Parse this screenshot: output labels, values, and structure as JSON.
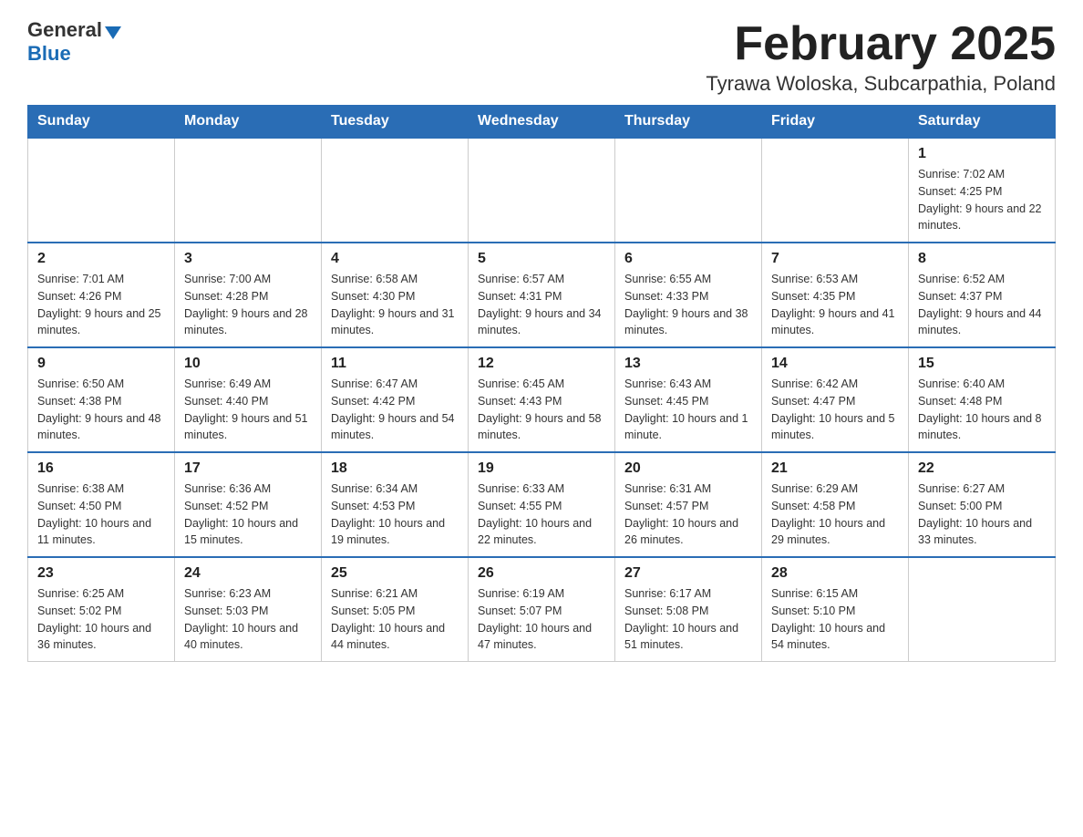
{
  "header": {
    "logo_general": "General",
    "logo_blue": "Blue",
    "month_title": "February 2025",
    "location": "Tyrawa Woloska, Subcarpathia, Poland"
  },
  "days_of_week": [
    "Sunday",
    "Monday",
    "Tuesday",
    "Wednesday",
    "Thursday",
    "Friday",
    "Saturday"
  ],
  "weeks": [
    {
      "days": [
        {
          "num": "",
          "info": ""
        },
        {
          "num": "",
          "info": ""
        },
        {
          "num": "",
          "info": ""
        },
        {
          "num": "",
          "info": ""
        },
        {
          "num": "",
          "info": ""
        },
        {
          "num": "",
          "info": ""
        },
        {
          "num": "1",
          "info": "Sunrise: 7:02 AM\nSunset: 4:25 PM\nDaylight: 9 hours and 22 minutes."
        }
      ]
    },
    {
      "days": [
        {
          "num": "2",
          "info": "Sunrise: 7:01 AM\nSunset: 4:26 PM\nDaylight: 9 hours and 25 minutes."
        },
        {
          "num": "3",
          "info": "Sunrise: 7:00 AM\nSunset: 4:28 PM\nDaylight: 9 hours and 28 minutes."
        },
        {
          "num": "4",
          "info": "Sunrise: 6:58 AM\nSunset: 4:30 PM\nDaylight: 9 hours and 31 minutes."
        },
        {
          "num": "5",
          "info": "Sunrise: 6:57 AM\nSunset: 4:31 PM\nDaylight: 9 hours and 34 minutes."
        },
        {
          "num": "6",
          "info": "Sunrise: 6:55 AM\nSunset: 4:33 PM\nDaylight: 9 hours and 38 minutes."
        },
        {
          "num": "7",
          "info": "Sunrise: 6:53 AM\nSunset: 4:35 PM\nDaylight: 9 hours and 41 minutes."
        },
        {
          "num": "8",
          "info": "Sunrise: 6:52 AM\nSunset: 4:37 PM\nDaylight: 9 hours and 44 minutes."
        }
      ]
    },
    {
      "days": [
        {
          "num": "9",
          "info": "Sunrise: 6:50 AM\nSunset: 4:38 PM\nDaylight: 9 hours and 48 minutes."
        },
        {
          "num": "10",
          "info": "Sunrise: 6:49 AM\nSunset: 4:40 PM\nDaylight: 9 hours and 51 minutes."
        },
        {
          "num": "11",
          "info": "Sunrise: 6:47 AM\nSunset: 4:42 PM\nDaylight: 9 hours and 54 minutes."
        },
        {
          "num": "12",
          "info": "Sunrise: 6:45 AM\nSunset: 4:43 PM\nDaylight: 9 hours and 58 minutes."
        },
        {
          "num": "13",
          "info": "Sunrise: 6:43 AM\nSunset: 4:45 PM\nDaylight: 10 hours and 1 minute."
        },
        {
          "num": "14",
          "info": "Sunrise: 6:42 AM\nSunset: 4:47 PM\nDaylight: 10 hours and 5 minutes."
        },
        {
          "num": "15",
          "info": "Sunrise: 6:40 AM\nSunset: 4:48 PM\nDaylight: 10 hours and 8 minutes."
        }
      ]
    },
    {
      "days": [
        {
          "num": "16",
          "info": "Sunrise: 6:38 AM\nSunset: 4:50 PM\nDaylight: 10 hours and 11 minutes."
        },
        {
          "num": "17",
          "info": "Sunrise: 6:36 AM\nSunset: 4:52 PM\nDaylight: 10 hours and 15 minutes."
        },
        {
          "num": "18",
          "info": "Sunrise: 6:34 AM\nSunset: 4:53 PM\nDaylight: 10 hours and 19 minutes."
        },
        {
          "num": "19",
          "info": "Sunrise: 6:33 AM\nSunset: 4:55 PM\nDaylight: 10 hours and 22 minutes."
        },
        {
          "num": "20",
          "info": "Sunrise: 6:31 AM\nSunset: 4:57 PM\nDaylight: 10 hours and 26 minutes."
        },
        {
          "num": "21",
          "info": "Sunrise: 6:29 AM\nSunset: 4:58 PM\nDaylight: 10 hours and 29 minutes."
        },
        {
          "num": "22",
          "info": "Sunrise: 6:27 AM\nSunset: 5:00 PM\nDaylight: 10 hours and 33 minutes."
        }
      ]
    },
    {
      "days": [
        {
          "num": "23",
          "info": "Sunrise: 6:25 AM\nSunset: 5:02 PM\nDaylight: 10 hours and 36 minutes."
        },
        {
          "num": "24",
          "info": "Sunrise: 6:23 AM\nSunset: 5:03 PM\nDaylight: 10 hours and 40 minutes."
        },
        {
          "num": "25",
          "info": "Sunrise: 6:21 AM\nSunset: 5:05 PM\nDaylight: 10 hours and 44 minutes."
        },
        {
          "num": "26",
          "info": "Sunrise: 6:19 AM\nSunset: 5:07 PM\nDaylight: 10 hours and 47 minutes."
        },
        {
          "num": "27",
          "info": "Sunrise: 6:17 AM\nSunset: 5:08 PM\nDaylight: 10 hours and 51 minutes."
        },
        {
          "num": "28",
          "info": "Sunrise: 6:15 AM\nSunset: 5:10 PM\nDaylight: 10 hours and 54 minutes."
        },
        {
          "num": "",
          "info": ""
        }
      ]
    }
  ]
}
